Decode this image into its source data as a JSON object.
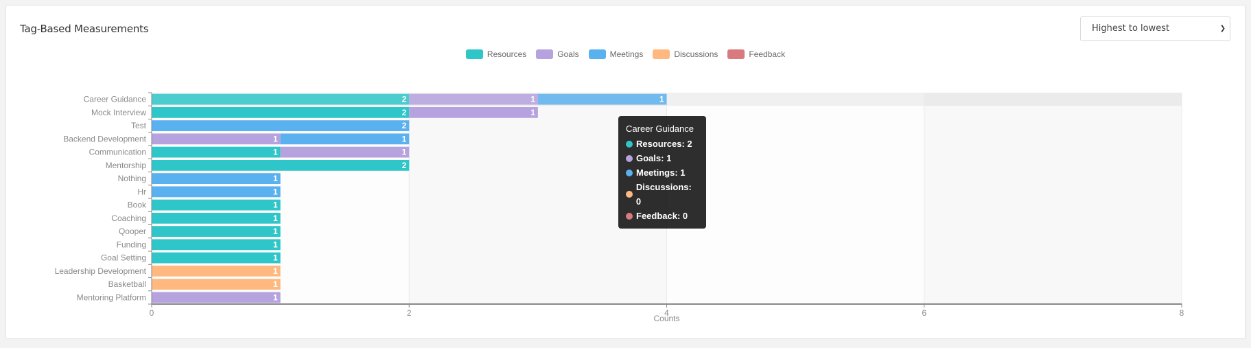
{
  "header": {
    "title": "Tag-Based Measurements"
  },
  "sort_select": {
    "selected": "Highest to lowest",
    "chevron_icon": "chevron-down-icon"
  },
  "chart_data": {
    "type": "bar",
    "orientation": "horizontal",
    "stacked": true,
    "title": "Tag-Based Measurements",
    "xlabel": "Counts",
    "ylabel": "",
    "xlim": [
      0,
      8
    ],
    "xticks": [
      "0",
      "2",
      "4",
      "6",
      "8"
    ],
    "grid": true,
    "legend_position": "top-center",
    "categories": [
      "Career Guidance",
      "Mock Interview",
      "Test",
      "Backend Development",
      "Communication",
      "Mentorship",
      "Nothing",
      "Hr",
      "Book",
      "Coaching",
      "Qooper",
      "Funding",
      "Goal Setting",
      "Leadership Development",
      "Basketball",
      "Mentoring Platform"
    ],
    "series": [
      {
        "name": "Resources",
        "color": "#2ec6c8",
        "values": [
          2,
          2,
          0,
          0,
          1,
          2,
          0,
          0,
          1,
          1,
          1,
          1,
          1,
          0,
          0,
          0
        ]
      },
      {
        "name": "Goals",
        "color": "#b6a2de",
        "values": [
          1,
          1,
          0,
          1,
          1,
          0,
          0,
          0,
          0,
          0,
          0,
          0,
          0,
          0,
          0,
          1
        ]
      },
      {
        "name": "Meetings",
        "color": "#5ab1ef",
        "values": [
          1,
          0,
          2,
          1,
          0,
          0,
          1,
          1,
          0,
          0,
          0,
          0,
          0,
          0,
          0,
          0
        ]
      },
      {
        "name": "Discussions",
        "color": "#ffb980",
        "values": [
          0,
          0,
          0,
          0,
          0,
          0,
          0,
          0,
          0,
          0,
          0,
          0,
          0,
          1,
          1,
          0
        ]
      },
      {
        "name": "Feedback",
        "color": "#d87a80",
        "values": [
          0,
          0,
          0,
          0,
          0,
          0,
          0,
          0,
          0,
          0,
          0,
          0,
          0,
          0,
          0,
          0
        ]
      }
    ],
    "highlighted_category": "Career Guidance"
  },
  "tooltip": {
    "title": "Career Guidance",
    "rows": [
      {
        "label": "Resources: 2",
        "color": "#2ec6c8"
      },
      {
        "label": "Goals: 1",
        "color": "#b6a2de"
      },
      {
        "label": "Meetings: 1",
        "color": "#5ab1ef"
      },
      {
        "label": "Discussions: 0",
        "color": "#ffb980"
      },
      {
        "label": "Feedback: 0",
        "color": "#d87a80"
      }
    ]
  }
}
